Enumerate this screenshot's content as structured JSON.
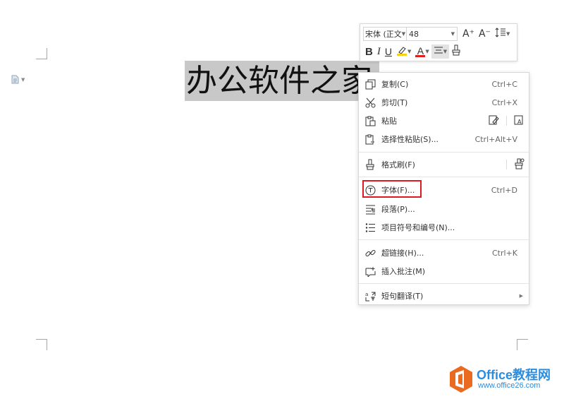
{
  "document": {
    "text": "办公软件之家"
  },
  "mini_toolbar": {
    "font_name": "宋体 (正文",
    "font_size": "48",
    "increase_font_icon": "A⁺",
    "decrease_font_icon": "A⁻",
    "bold": "B",
    "italic": "I",
    "underline": "U",
    "font_color_letter": "A"
  },
  "context_menu": {
    "items": [
      {
        "label": "复制(C)",
        "shortcut": "Ctrl+C",
        "icon": "copy-icon"
      },
      {
        "label": "剪切(T)",
        "shortcut": "Ctrl+X",
        "icon": "scissors-icon"
      },
      {
        "label": "粘贴",
        "shortcut": "",
        "icon": "paste-icon"
      },
      {
        "label": "选择性粘贴(S)...",
        "shortcut": "Ctrl+Alt+V",
        "icon": "paste-special-icon"
      },
      {
        "label": "格式刷(F)",
        "shortcut": "",
        "icon": "format-brush-icon"
      },
      {
        "label": "字体(F)...",
        "shortcut": "Ctrl+D",
        "icon": "font-icon"
      },
      {
        "label": "段落(P)...",
        "shortcut": "",
        "icon": "paragraph-icon"
      },
      {
        "label": "项目符号和编号(N)...",
        "shortcut": "",
        "icon": "bullets-icon"
      },
      {
        "label": "超链接(H)...",
        "shortcut": "Ctrl+K",
        "icon": "link-icon"
      },
      {
        "label": "插入批注(M)",
        "shortcut": "",
        "icon": "comment-icon"
      },
      {
        "label": "短句翻译(T)",
        "shortcut": "",
        "icon": "translate-icon"
      }
    ],
    "highlighted_item": "字体(F)..."
  },
  "watermark": {
    "brand": "Office教程网",
    "url": "www.office26.com",
    "logo_color": "#ea6a1f",
    "text_color": "#2b8de0"
  }
}
